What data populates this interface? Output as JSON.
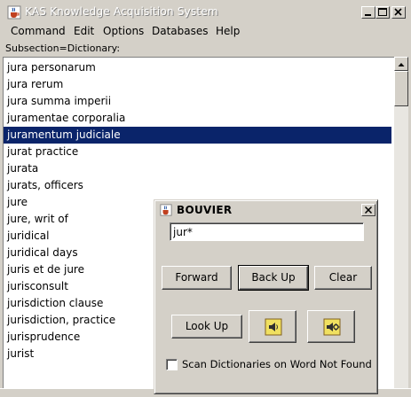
{
  "window": {
    "title": "KAS Knowledge Acquisition System"
  },
  "menu": [
    "Command",
    "Edit",
    "Options",
    "Databases",
    "Help"
  ],
  "subsection_label": "Subsection=Dictionary:",
  "list": {
    "items": [
      "jura personarum",
      "jura rerum",
      "jura summa imperii",
      "juramentae corporalia",
      "juramentum judiciale",
      "jurat practice",
      "jurata",
      "jurats, officers",
      "jure",
      "jure, writ of",
      "juridical",
      "juridical days",
      "juris et de jure",
      "jurisconsult",
      "jurisdiction clause",
      "jurisdiction, practice",
      "jurisprudence",
      "jurist"
    ],
    "selected_index": 4
  },
  "dialog": {
    "title": "BOUVIER",
    "search_value": "jur*",
    "forward_label": "Forward",
    "backup_label": "Back Up",
    "clear_label": "Clear",
    "lookup_label": "Look Up",
    "checkbox_label": "Scan Dictionaries on Word Not Found",
    "checkbox_checked": false
  },
  "colors": {
    "selection": "#0a246a",
    "desktop": "#3a6ea5",
    "face": "#d4d0c8"
  }
}
